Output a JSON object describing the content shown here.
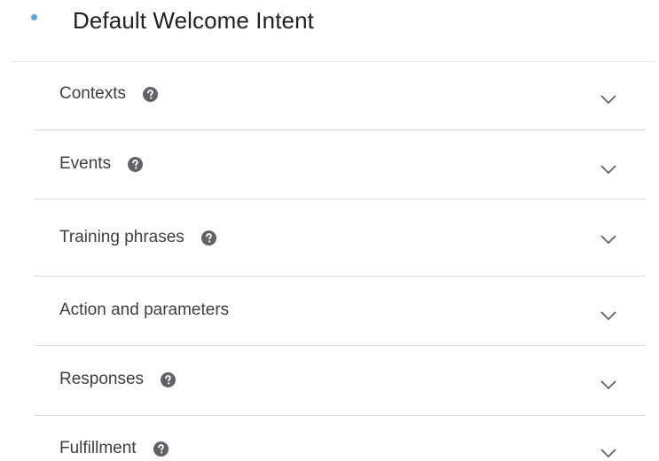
{
  "header": {
    "title": "Default Welcome Intent",
    "status_dot_color": "#5aa5dd"
  },
  "sections": [
    {
      "label": "Contexts",
      "has_help": true,
      "expanded": false
    },
    {
      "label": "Events",
      "has_help": true,
      "expanded": false
    },
    {
      "label": "Training phrases",
      "has_help": true,
      "expanded": false
    },
    {
      "label": "Action and parameters",
      "has_help": false,
      "expanded": false
    },
    {
      "label": "Responses",
      "has_help": true,
      "expanded": false
    },
    {
      "label": "Fulfillment",
      "has_help": true,
      "expanded": false
    }
  ],
  "icons": {
    "help": "help-circle-icon",
    "expand": "chevron-down-icon"
  },
  "colors": {
    "icon": "#5f6368",
    "divider": "#dcdcdc",
    "text": "#3c4043"
  }
}
